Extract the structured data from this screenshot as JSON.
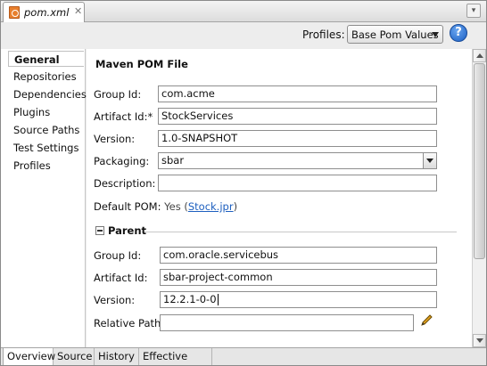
{
  "editor_tab": {
    "filename": "pom.xml",
    "close_glyph": "✕",
    "icon": "xml-file-icon"
  },
  "toolbar": {
    "profiles_label": "Profiles:",
    "profiles_value": "Base Pom Values",
    "help_glyph": "?"
  },
  "nav": {
    "items": [
      {
        "label": "General",
        "active": true
      },
      {
        "label": "Repositories"
      },
      {
        "label": "Dependencies"
      },
      {
        "label": "Plugins"
      },
      {
        "label": "Source Paths"
      },
      {
        "label": "Test Settings"
      },
      {
        "label": "Profiles"
      }
    ]
  },
  "main": {
    "heading": "Maven POM File",
    "group_id_label": "Group Id:",
    "group_id": "com.acme",
    "artifact_id_label": "Artifact Id:*",
    "artifact_id": "StockServices",
    "version_label": "Version:",
    "version": "1.0-SNAPSHOT",
    "packaging_label": "Packaging:",
    "packaging": "sbar",
    "description_label": "Description:",
    "description": "",
    "default_pom_label": "Default POM:",
    "default_pom_yes": "Yes",
    "default_pom_link": "Stock.jpr"
  },
  "parent": {
    "title": "Parent",
    "group_id_label": "Group Id:",
    "group_id": "com.oracle.servicebus",
    "artifact_id_label": "Artifact Id:",
    "artifact_id": "sbar-project-common",
    "version_label": "Version:",
    "version": "12.2.1-0-0",
    "relative_path_label": "Relative Path:",
    "relative_path": ""
  },
  "bottom_tabs": [
    {
      "label": "Overview",
      "active": true
    },
    {
      "label": "Source"
    },
    {
      "label": "History"
    },
    {
      "label": "Effective POM"
    }
  ]
}
